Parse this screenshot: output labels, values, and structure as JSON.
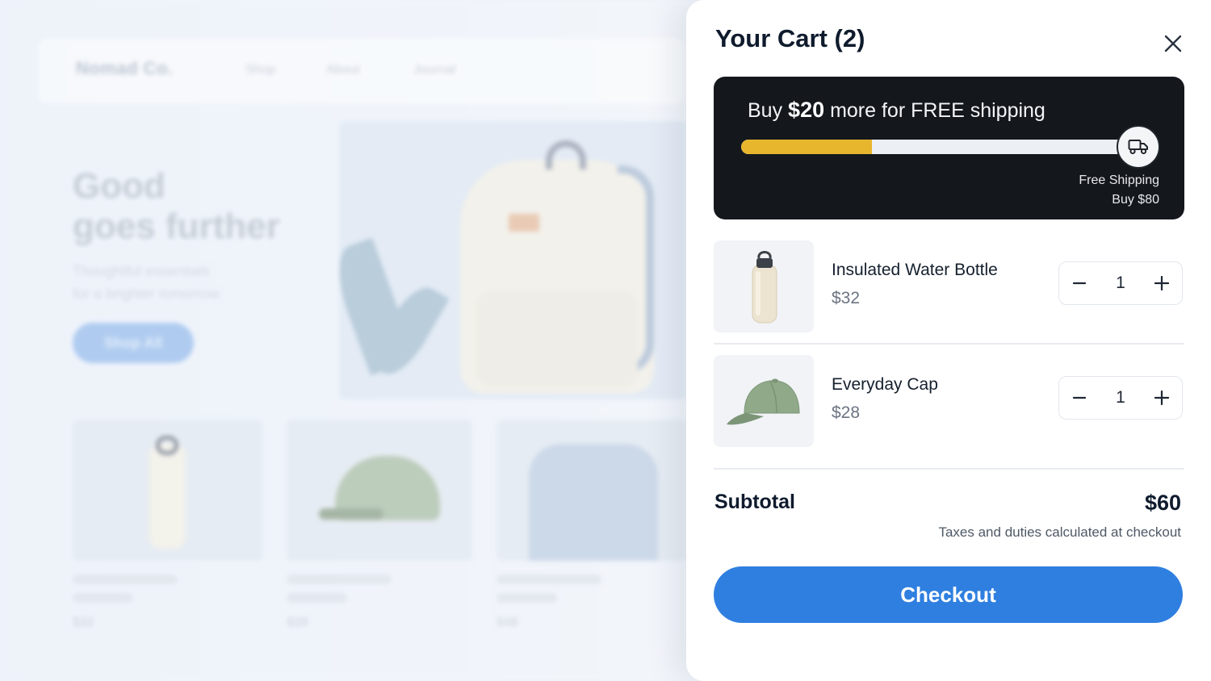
{
  "background": {
    "brand": "Nomad Co.",
    "nav_links": [
      "Shop",
      "About",
      "Journal"
    ],
    "hero_title_line1": "Good",
    "hero_title_line2": "goes further",
    "hero_sub_line1": "Thoughtful essentials",
    "hero_sub_line2": "for a brighter tomorrow",
    "hero_button": "Shop All",
    "product_prices": [
      "$32",
      "$28",
      "$48"
    ]
  },
  "cart": {
    "title": "Your Cart (2)",
    "shipping": {
      "prefix": "Buy",
      "amount": "$20",
      "suffix": "more for FREE shipping",
      "progress": 0.33,
      "goal_label": "Free Shipping",
      "goal_amount": "Buy $80",
      "icon": "truck-icon"
    },
    "items": [
      {
        "name": "Insulated Water Bottle",
        "price": "$32",
        "qty": "1",
        "icon": "water-bottle"
      },
      {
        "name": "Everyday Cap",
        "price": "$28",
        "qty": "1",
        "icon": "cap"
      }
    ],
    "subtotal_label": "Subtotal",
    "subtotal_value": "$60",
    "tax_note": "Taxes and duties calculated at checkout",
    "checkout_label": "Checkout"
  },
  "colors": {
    "accent": "#2f7fe0",
    "banner_bg": "#14181d",
    "progress_fill": "#e8b62c"
  }
}
